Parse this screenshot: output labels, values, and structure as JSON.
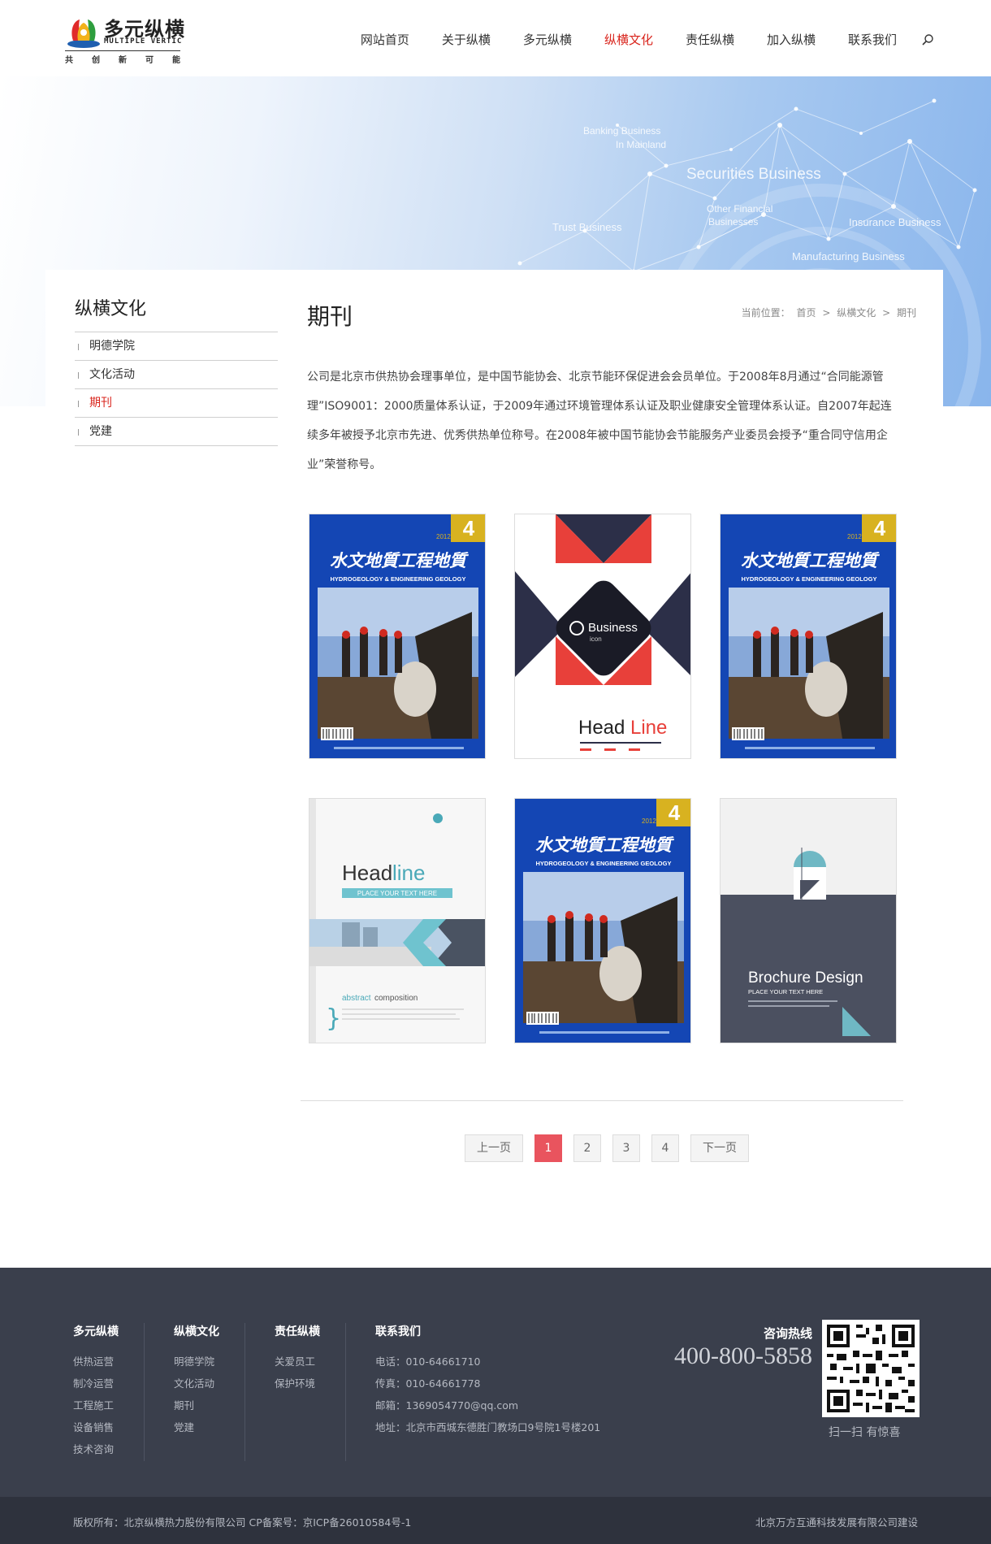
{
  "header": {
    "logo": {
      "name_cn": "多元纵横",
      "name_en": "MULTIPLE VERTIC",
      "slogan": [
        "共",
        "创",
        "新",
        "可",
        "能"
      ]
    },
    "nav": [
      {
        "label": "网站首页",
        "active": false
      },
      {
        "label": "关于纵横",
        "active": false
      },
      {
        "label": "多元纵横",
        "active": false
      },
      {
        "label": "纵横文化",
        "active": true
      },
      {
        "label": "责任纵横",
        "active": false
      },
      {
        "label": "加入纵横",
        "active": false
      },
      {
        "label": "联系我们",
        "active": false
      }
    ],
    "search_icon": "search-icon",
    "active_color": "#d9241c"
  },
  "banner": {
    "texts": [
      "Banking Business",
      "In Mainland",
      "Securities Business",
      "Other Financial",
      "Businesses",
      "Trust Business",
      "Insurance Business",
      "Manufacturing Business"
    ]
  },
  "sidebar": {
    "title": "纵横文化",
    "items": [
      {
        "label": "明德学院",
        "active": false
      },
      {
        "label": "文化活动",
        "active": false
      },
      {
        "label": "期刊",
        "active": true
      },
      {
        "label": "党建",
        "active": false
      }
    ]
  },
  "main": {
    "title": "期刊",
    "breadcrumb": {
      "prefix": "当前位置：",
      "items": [
        "首页",
        "纵横文化",
        "期刊"
      ],
      "separator": ">"
    },
    "intro": "公司是北京市供热协会理事单位，是中国节能协会、北京节能环保促进会会员单位。于2008年8月通过“合同能源管理”ISO9001：2000质量体系认证，于2009年通过环境管理体系认证及职业健康安全管理体系认证。自2007年起连续多年被授予北京市先进、优秀供热单位称号。在2008年被中国节能协会节能服务产业委员会授予“重合同守信用企业”荣誉称号。",
    "covers": [
      {
        "type": "magazine",
        "issue": "4",
        "year": "2012",
        "title_cn": "水文地質工程地質",
        "title_en": "HYDROGEOLOGY & ENGINEERING GEOLOGY"
      },
      {
        "type": "business",
        "title1": "Business",
        "title2": "icon",
        "headline_a": "Head",
        "headline_b": "Line"
      },
      {
        "type": "magazine",
        "issue": "4",
        "year": "2012",
        "title_cn": "水文地質工程地質",
        "title_en": "HYDROGEOLOGY & ENGINEERING GEOLOGY"
      },
      {
        "type": "headline",
        "headline_a": "Head",
        "headline_b": "line",
        "sub": "PLACE YOUR TEXT HERE",
        "abstract_a": "abstract",
        "abstract_b": " composition"
      },
      {
        "type": "magazine",
        "issue": "4",
        "year": "2012",
        "title_cn": "水文地質工程地質",
        "title_en": "HYDROGEOLOGY & ENGINEERING GEOLOGY"
      },
      {
        "type": "brochure",
        "title": "Brochure Design",
        "sub": "PLACE YOUR TEXT HERE"
      }
    ]
  },
  "pagination": {
    "prev": "上一页",
    "pages": [
      "1",
      "2",
      "3",
      "4"
    ],
    "current": "1",
    "next": "下一页",
    "current_color": "#e9545e"
  },
  "footer": {
    "columns": [
      {
        "title": "多元纵横",
        "items": [
          "供热运营",
          "制冷运营",
          "工程施工",
          "设备销售",
          "技术咨询"
        ]
      },
      {
        "title": "纵横文化",
        "items": [
          "明德学院",
          "文化活动",
          "期刊",
          "党建"
        ]
      },
      {
        "title": "责任纵横",
        "items": [
          "关爱员工",
          "保护环境"
        ]
      }
    ],
    "contact": {
      "title": "联系我们",
      "items": [
        "电话：010-64661710",
        "传真：010-64661778",
        "邮箱：1369054770@qq.com",
        "地址：北京市西城东德胜门教场口9号院1号楼201"
      ]
    },
    "hotline_label": "咨询热线",
    "hotline": "400-800-5858",
    "qr_caption": "扫一扫 有惊喜",
    "background": "#3a3f4c"
  },
  "copyright": {
    "left": "版权所有：北京纵横热力股份有限公司 CP备案号：京ICP备26010584号-1",
    "right": "北京万方互通科技发展有限公司建设"
  }
}
